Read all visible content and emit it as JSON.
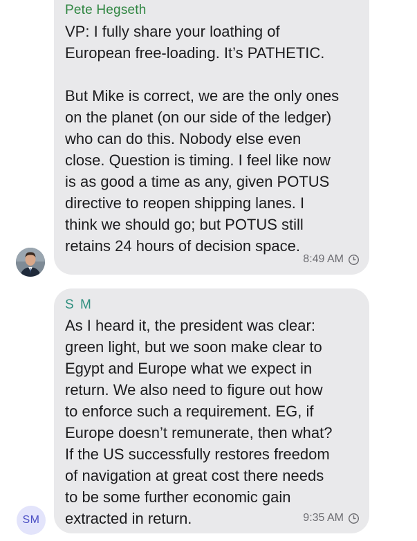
{
  "messages": [
    {
      "sender": "Pete Hegseth",
      "text": "VP: I fully share your loathing of\nEuropean free-loading. It’s PATHETIC.\n\nBut Mike is correct, we are the only ones\non the planet (on our side of the ledger)\nwho can do this. Nobody else even\nclose. Question is timing. I feel like now\nis as good a time as any, given POTUS\ndirective to reopen shipping lanes. I\nthink we should go; but POTUS still\nretains 24 hours of decision space.",
      "time": "8:49 AM",
      "avatar": "photo"
    },
    {
      "sender": "S M",
      "text": "As I heard it, the president was clear:\ngreen light, but we soon make clear to\nEgypt and Europe what we expect in\nreturn. We also need to figure out how\nto enforce such a requirement. EG, if\nEurope doesn’t remunerate, then what?\nIf the US successfully restores freedom\nof navigation at great cost there needs\nto be some further economic gain\nextracted in return.",
      "time": "9:35 AM",
      "avatar_initials": "SM"
    }
  ],
  "icons": {
    "timer": "clock-icon"
  },
  "colors": {
    "bubble": "#e9e9eb",
    "sender1": "#2e8540",
    "sender2": "#2f8f7f",
    "avatar_initials_bg": "#e3e4fb",
    "avatar_initials_fg": "#4b4fc4"
  }
}
